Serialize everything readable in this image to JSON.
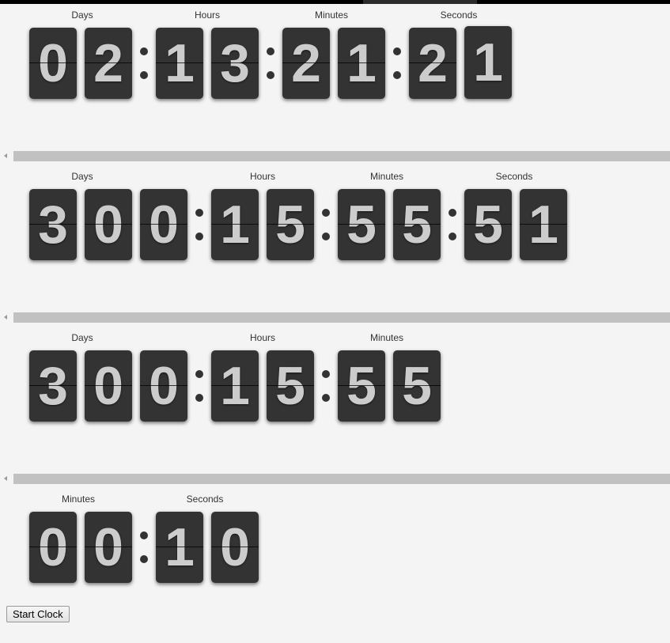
{
  "clocks": [
    {
      "labels": [
        "Days",
        "Hours",
        "Minutes",
        "Seconds"
      ],
      "groups": [
        [
          "0",
          "2"
        ],
        [
          "1",
          "3"
        ],
        [
          "2",
          "1"
        ],
        [
          "2",
          "1"
        ]
      ],
      "flipping_last_digit": true
    },
    {
      "labels": [
        "Days",
        "Hours",
        "Minutes",
        "Seconds"
      ],
      "groups": [
        [
          "3",
          "0",
          "0"
        ],
        [
          "1",
          "5"
        ],
        [
          "5",
          "5"
        ],
        [
          "5",
          "1"
        ]
      ]
    },
    {
      "labels": [
        "Days",
        "Hours",
        "Minutes"
      ],
      "groups": [
        [
          "3",
          "0",
          "0"
        ],
        [
          "1",
          "5"
        ],
        [
          "5",
          "5"
        ]
      ]
    },
    {
      "labels": [
        "Minutes",
        "Seconds"
      ],
      "groups": [
        [
          "0",
          "0"
        ],
        [
          "1",
          "0"
        ]
      ]
    }
  ],
  "icons": {
    "scroll_left": "triangle-left-icon"
  },
  "controls": {
    "start_button": "Start Clock"
  }
}
